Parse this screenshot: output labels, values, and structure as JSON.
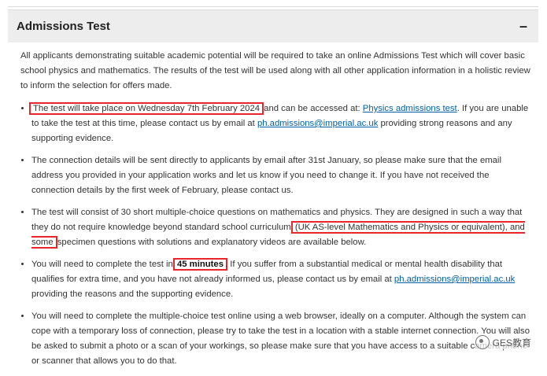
{
  "panel": {
    "title": "Admissions Test",
    "toggle": "–"
  },
  "intro": "All applicants demonstrating suitable academic potential will be required to take an online Admissions Test which will cover basic school physics and mathematics. The results of the test will be used along with all other application information in a holistic review to inform the selection for offers made.",
  "bullets": {
    "b1": {
      "highlight": "The test will take place on Wednesday 7th February 2024",
      "mid": " and can be accessed at: ",
      "link": "Physics admissions test",
      "after_link": ".  If you are unable to take the test at this time, please contact us by email at ",
      "email": "ph.admissions@imperial.ac.uk",
      "end": " providing strong reasons and any supporting evidence."
    },
    "b2": {
      "text": "The connection details will be sent directly to applicants by email after 31st January, so please make sure that the email address you provided in your application works and let us know if you need to change it. If you have not received the connection details by the first week of February, please contact us."
    },
    "b3": {
      "start": "The test will consist of 30 short multiple-choice questions on mathematics and physics. They are designed in such a way that they do not require knowledge beyond standard school curriculum ",
      "highlight": "(UK AS-level Mathematics and Physics or equivalent), and some",
      "end": " specimen questions with solutions and explanatory videos are available below."
    },
    "b4": {
      "start": "You will need to complete the test in ",
      "highlight": "45 minutes",
      "mid": ". If you suffer from a substantial medical or mental health disability that qualifies for extra time, and you have not already informed us, please contact us by email at ",
      "email": "ph.admissions@imperial.ac.uk",
      "end": " providing the reasons and the supporting evidence."
    },
    "b5": {
      "text": "You will need to complete the multiple-choice test online using a web browser, ideally on a computer. Although the system can cope with a temporary loss of connection, please try to take the test in a location with a stable internet connection.  You will also be asked to submit a photo or a scan of your workings, so please make sure that you have access to a suitable camera phone or scanner that allows you to do that."
    }
  },
  "watermark": "GES教育",
  "colors": {
    "highlight_border": "#e8262c",
    "link": "#0060a8",
    "header_bg": "#ededed"
  }
}
